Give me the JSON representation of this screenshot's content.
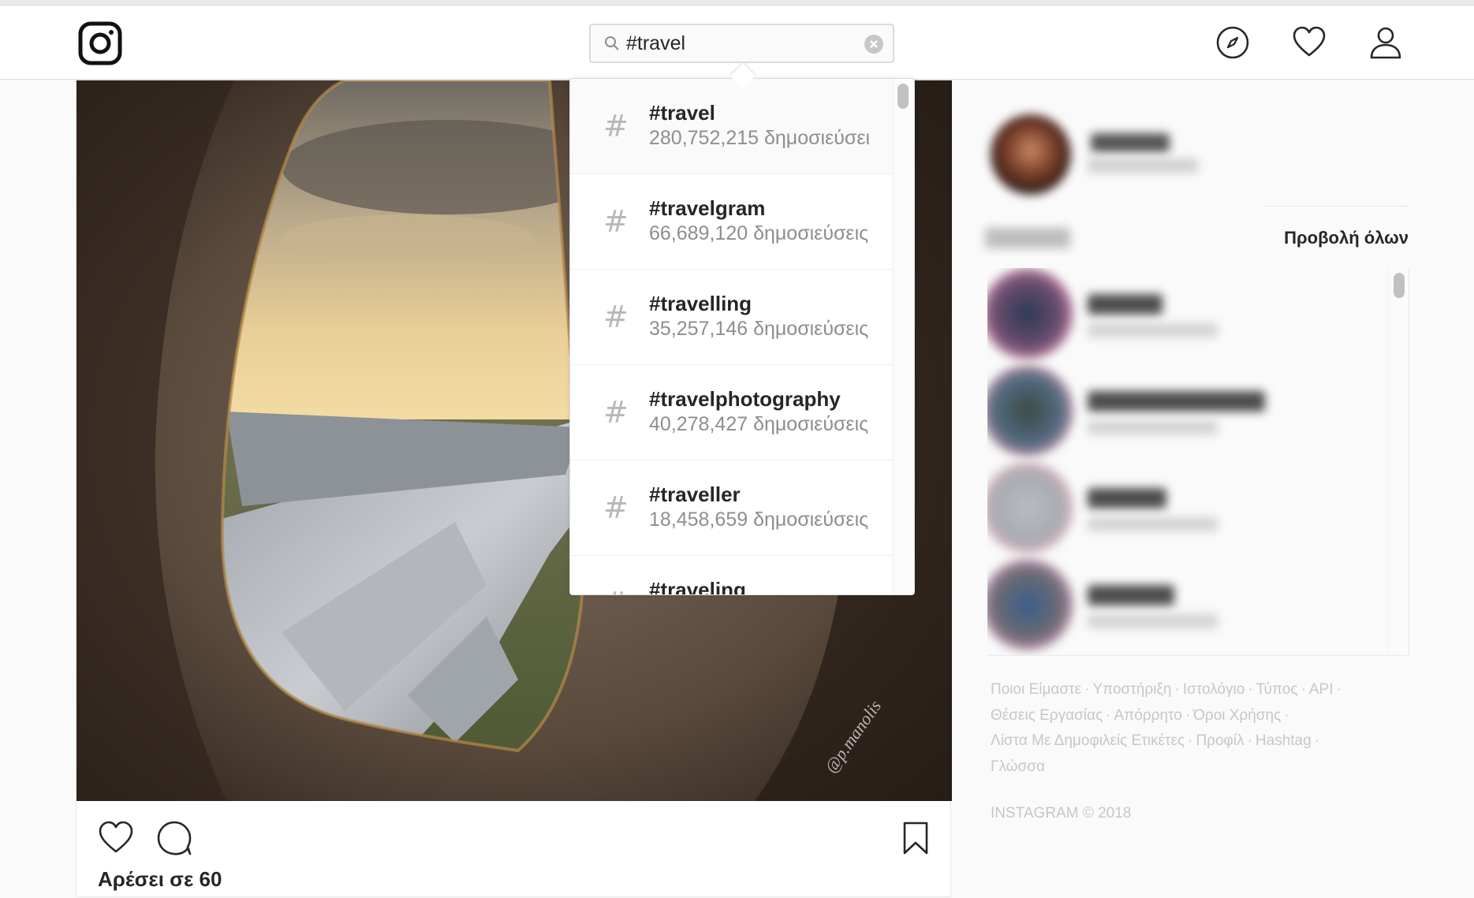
{
  "search": {
    "value": "#travel"
  },
  "results": [
    {
      "tag": "#travel",
      "count": "280,752,215 δημοσιεύσει"
    },
    {
      "tag": "#travelgram",
      "count": "66,689,120 δημοσιεύσεις"
    },
    {
      "tag": "#travelling",
      "count": "35,257,146 δημοσιεύσεις"
    },
    {
      "tag": "#travelphotography",
      "count": "40,278,427 δημοσιεύσεις"
    },
    {
      "tag": "#traveller",
      "count": "18,458,659 δημοσιεύσεις"
    },
    {
      "tag": "#traveling",
      "count": ""
    }
  ],
  "result_hash_symbol": "#",
  "post": {
    "likes": "Αρέσει σε 60",
    "watermark": "@p.manolis"
  },
  "sidebar": {
    "view_all": "Προβολή όλων"
  },
  "footer": {
    "links": [
      "Ποιοι Είμαστε",
      "Υποστήριξη",
      "Ιστολόγιο",
      "Τύπος",
      "API",
      "Θέσεις Εργασίας",
      "Απόρρητο",
      "Όροι Χρήσης",
      "Λίστα Με Δημοφιλείς Ετικέτες",
      "Προφίλ",
      "Hashtag",
      "Γλώσσα"
    ],
    "copyright": "INSTAGRAM © 2018"
  },
  "icons": {
    "logo": "instagram-logo",
    "search": "search-icon",
    "clear": "clear-icon",
    "explore": "compass-icon",
    "activity": "heart-icon",
    "profile": "user-icon",
    "like": "heart-outline-icon",
    "comment": "comment-icon",
    "save": "bookmark-icon"
  }
}
